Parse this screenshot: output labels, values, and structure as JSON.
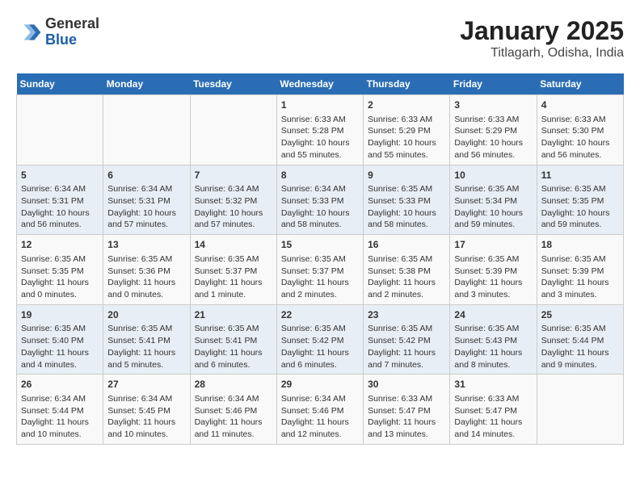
{
  "logo": {
    "general": "General",
    "blue": "Blue"
  },
  "title": "January 2025",
  "subtitle": "Titlagarh, Odisha, India",
  "days_of_week": [
    "Sunday",
    "Monday",
    "Tuesday",
    "Wednesday",
    "Thursday",
    "Friday",
    "Saturday"
  ],
  "weeks": [
    {
      "days": [
        {
          "num": "",
          "info": ""
        },
        {
          "num": "",
          "info": ""
        },
        {
          "num": "",
          "info": ""
        },
        {
          "num": "1",
          "info": "Sunrise: 6:33 AM\nSunset: 5:28 PM\nDaylight: 10 hours\nand 55 minutes."
        },
        {
          "num": "2",
          "info": "Sunrise: 6:33 AM\nSunset: 5:29 PM\nDaylight: 10 hours\nand 55 minutes."
        },
        {
          "num": "3",
          "info": "Sunrise: 6:33 AM\nSunset: 5:29 PM\nDaylight: 10 hours\nand 56 minutes."
        },
        {
          "num": "4",
          "info": "Sunrise: 6:33 AM\nSunset: 5:30 PM\nDaylight: 10 hours\nand 56 minutes."
        }
      ]
    },
    {
      "days": [
        {
          "num": "5",
          "info": "Sunrise: 6:34 AM\nSunset: 5:31 PM\nDaylight: 10 hours\nand 56 minutes."
        },
        {
          "num": "6",
          "info": "Sunrise: 6:34 AM\nSunset: 5:31 PM\nDaylight: 10 hours\nand 57 minutes."
        },
        {
          "num": "7",
          "info": "Sunrise: 6:34 AM\nSunset: 5:32 PM\nDaylight: 10 hours\nand 57 minutes."
        },
        {
          "num": "8",
          "info": "Sunrise: 6:34 AM\nSunset: 5:33 PM\nDaylight: 10 hours\nand 58 minutes."
        },
        {
          "num": "9",
          "info": "Sunrise: 6:35 AM\nSunset: 5:33 PM\nDaylight: 10 hours\nand 58 minutes."
        },
        {
          "num": "10",
          "info": "Sunrise: 6:35 AM\nSunset: 5:34 PM\nDaylight: 10 hours\nand 59 minutes."
        },
        {
          "num": "11",
          "info": "Sunrise: 6:35 AM\nSunset: 5:35 PM\nDaylight: 10 hours\nand 59 minutes."
        }
      ]
    },
    {
      "days": [
        {
          "num": "12",
          "info": "Sunrise: 6:35 AM\nSunset: 5:35 PM\nDaylight: 11 hours\nand 0 minutes."
        },
        {
          "num": "13",
          "info": "Sunrise: 6:35 AM\nSunset: 5:36 PM\nDaylight: 11 hours\nand 0 minutes."
        },
        {
          "num": "14",
          "info": "Sunrise: 6:35 AM\nSunset: 5:37 PM\nDaylight: 11 hours\nand 1 minute."
        },
        {
          "num": "15",
          "info": "Sunrise: 6:35 AM\nSunset: 5:37 PM\nDaylight: 11 hours\nand 2 minutes."
        },
        {
          "num": "16",
          "info": "Sunrise: 6:35 AM\nSunset: 5:38 PM\nDaylight: 11 hours\nand 2 minutes."
        },
        {
          "num": "17",
          "info": "Sunrise: 6:35 AM\nSunset: 5:39 PM\nDaylight: 11 hours\nand 3 minutes."
        },
        {
          "num": "18",
          "info": "Sunrise: 6:35 AM\nSunset: 5:39 PM\nDaylight: 11 hours\nand 3 minutes."
        }
      ]
    },
    {
      "days": [
        {
          "num": "19",
          "info": "Sunrise: 6:35 AM\nSunset: 5:40 PM\nDaylight: 11 hours\nand 4 minutes."
        },
        {
          "num": "20",
          "info": "Sunrise: 6:35 AM\nSunset: 5:41 PM\nDaylight: 11 hours\nand 5 minutes."
        },
        {
          "num": "21",
          "info": "Sunrise: 6:35 AM\nSunset: 5:41 PM\nDaylight: 11 hours\nand 6 minutes."
        },
        {
          "num": "22",
          "info": "Sunrise: 6:35 AM\nSunset: 5:42 PM\nDaylight: 11 hours\nand 6 minutes."
        },
        {
          "num": "23",
          "info": "Sunrise: 6:35 AM\nSunset: 5:42 PM\nDaylight: 11 hours\nand 7 minutes."
        },
        {
          "num": "24",
          "info": "Sunrise: 6:35 AM\nSunset: 5:43 PM\nDaylight: 11 hours\nand 8 minutes."
        },
        {
          "num": "25",
          "info": "Sunrise: 6:35 AM\nSunset: 5:44 PM\nDaylight: 11 hours\nand 9 minutes."
        }
      ]
    },
    {
      "days": [
        {
          "num": "26",
          "info": "Sunrise: 6:34 AM\nSunset: 5:44 PM\nDaylight: 11 hours\nand 10 minutes."
        },
        {
          "num": "27",
          "info": "Sunrise: 6:34 AM\nSunset: 5:45 PM\nDaylight: 11 hours\nand 10 minutes."
        },
        {
          "num": "28",
          "info": "Sunrise: 6:34 AM\nSunset: 5:46 PM\nDaylight: 11 hours\nand 11 minutes."
        },
        {
          "num": "29",
          "info": "Sunrise: 6:34 AM\nSunset: 5:46 PM\nDaylight: 11 hours\nand 12 minutes."
        },
        {
          "num": "30",
          "info": "Sunrise: 6:33 AM\nSunset: 5:47 PM\nDaylight: 11 hours\nand 13 minutes."
        },
        {
          "num": "31",
          "info": "Sunrise: 6:33 AM\nSunset: 5:47 PM\nDaylight: 11 hours\nand 14 minutes."
        },
        {
          "num": "",
          "info": ""
        }
      ]
    }
  ]
}
